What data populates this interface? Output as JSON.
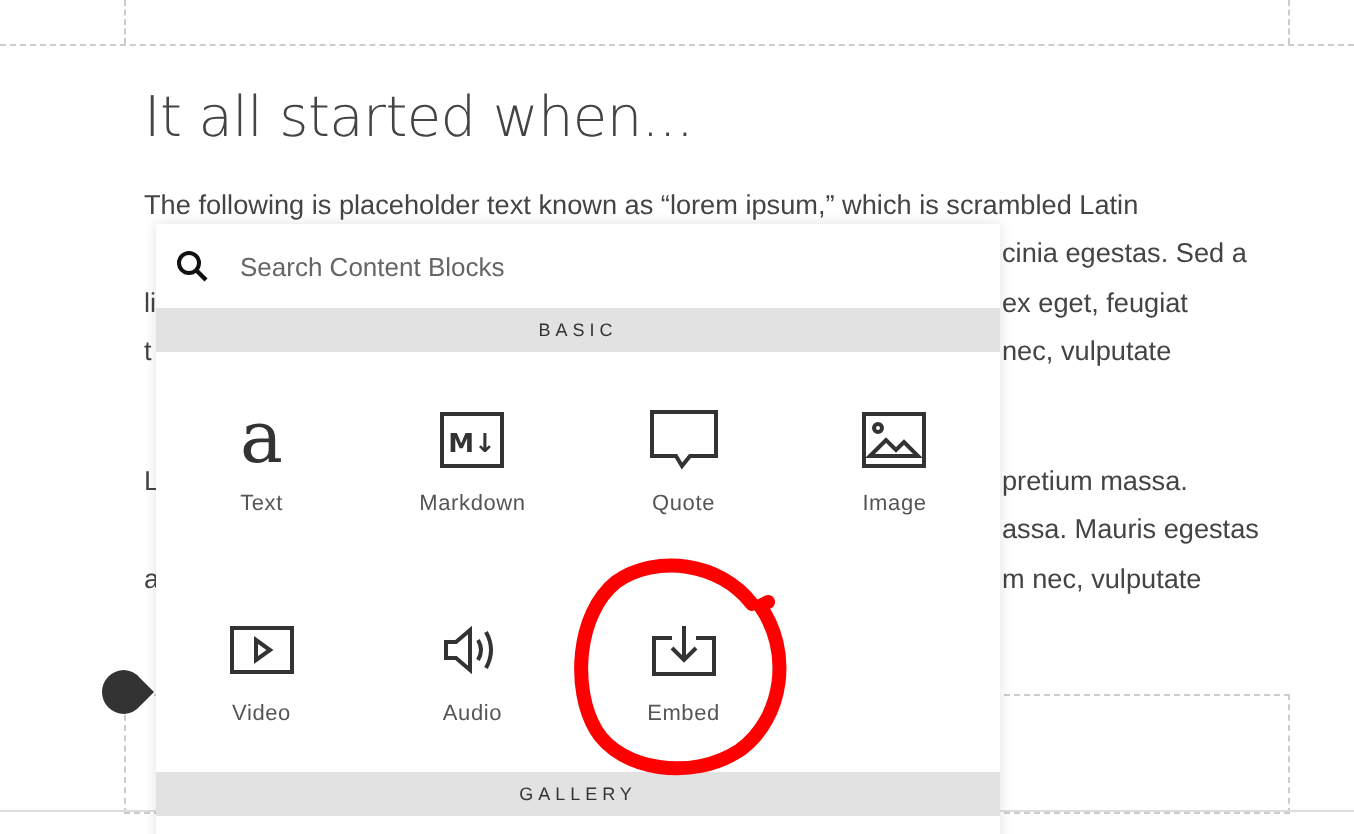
{
  "heading": "It all started when...",
  "paragraphs": [
    [
      {
        "left": "The following is placeholder text known as “lorem ipsum,” which is scrambled Latin"
      },
      {
        "right": "cinia egestas. Sed a"
      },
      {
        "left": "li",
        "right": "ex eget, feugiat"
      },
      {
        "left": "t",
        "right": "nec, vulputate"
      }
    ],
    [
      {
        "left": "L",
        "right": "pretium massa."
      },
      {
        "right": "assa. Mauris egestas"
      },
      {
        "left": "a",
        "right": "m nec, vulputate"
      }
    ]
  ],
  "popup": {
    "search": {
      "placeholder": "Search Content Blocks"
    },
    "sections": [
      {
        "title": "BASIC",
        "blocks": [
          {
            "kind": "text",
            "glyph": "a",
            "label": "Text"
          },
          {
            "kind": "markdown",
            "glyph": "M↓",
            "label": "Markdown"
          },
          {
            "kind": "quote",
            "label": "Quote"
          },
          {
            "kind": "image",
            "label": "Image"
          },
          {
            "kind": "video",
            "label": "Video"
          },
          {
            "kind": "audio",
            "label": "Audio"
          },
          {
            "kind": "embed",
            "label": "Embed"
          }
        ]
      },
      {
        "title": "GALLERY"
      }
    ]
  }
}
